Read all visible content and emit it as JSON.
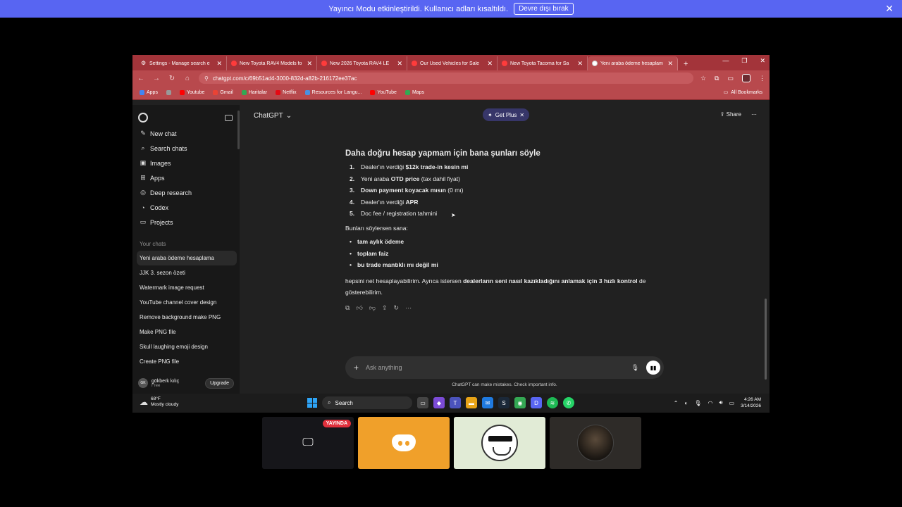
{
  "banner": {
    "text": "Yayıncı Modu etkinleştirildi. Kullanıcı adları kısaltıldı.",
    "button": "Devre dışı bırak",
    "close": "✕"
  },
  "browser": {
    "tabs": [
      {
        "title": "Settings - Manage search e",
        "icon": "gear-icon",
        "active": false
      },
      {
        "title": "New Toyota RAV4 Models fo",
        "icon": "toyota-icon",
        "active": false
      },
      {
        "title": "New 2026 Toyota RAV4 LE",
        "icon": "toyota-icon",
        "active": false
      },
      {
        "title": "Our Used Vehicles for Sale",
        "icon": "toyota-icon",
        "active": false
      },
      {
        "title": "New Toyota Tacoma for Sa",
        "icon": "toyota-icon",
        "active": false
      },
      {
        "title": "Yeni araba ödeme hesaplam",
        "icon": "chatgpt-icon",
        "active": true
      }
    ],
    "url": "chatgpt.com/c/69b51ad4-3000-832d-a82b-216172ee37ac",
    "bookmarks": [
      {
        "label": "Apps",
        "color": "#4285f4"
      },
      {
        "label": "",
        "color": "#999999"
      },
      {
        "label": "Youtube",
        "color": "#ff0000"
      },
      {
        "label": "Gmail",
        "color": "#ea4335"
      },
      {
        "label": "Haritalar",
        "color": "#34a853"
      },
      {
        "label": "Netflix",
        "color": "#e50914"
      },
      {
        "label": "Resources for Langu...",
        "color": "#4a90e2"
      },
      {
        "label": "YouTube",
        "color": "#ff0000"
      },
      {
        "label": "Maps",
        "color": "#34a853"
      }
    ],
    "all_bookmarks": "All Bookmarks"
  },
  "sidebar": {
    "items": [
      {
        "label": "New chat",
        "icon": "✎"
      },
      {
        "label": "Search chats",
        "icon": "⌕"
      },
      {
        "label": "Images",
        "icon": "▣"
      },
      {
        "label": "Apps",
        "icon": "⊞"
      },
      {
        "label": "Deep research",
        "icon": "◎"
      },
      {
        "label": "Codex",
        "icon": "◔"
      },
      {
        "label": "Projects",
        "icon": "▭"
      }
    ],
    "section_title": "Your chats",
    "chats": [
      "Yeni araba ödeme hesaplama",
      "JJK 3. sezon özeti",
      "Watermark image request",
      "YouTube channel cover design",
      "Remove background make PNG",
      "Make PNG file",
      "Skull laughing emoji design",
      "Create PNG file"
    ],
    "user": {
      "initials": "GK",
      "name": "gökberk kılıç",
      "plan": "Free",
      "upgrade": "Upgrade"
    }
  },
  "main": {
    "model": "ChatGPT",
    "get_plus": "Get Plus",
    "share": "Share",
    "heading": "Daha doğru hesap yapmam için bana şunları söyle",
    "list": [
      {
        "num": "1.",
        "pre": "Dealer'ın verdiği ",
        "bold": "$12k trade-in kesin mi",
        "post": ""
      },
      {
        "num": "2.",
        "pre": "Yeni araba ",
        "bold": "OTD price",
        "post": " (tax dahil fiyat)"
      },
      {
        "num": "3.",
        "pre": "",
        "bold": "Down payment koyacak mısın",
        "post": " (0 mı)"
      },
      {
        "num": "4.",
        "pre": "Dealer'ın verdiği ",
        "bold": "APR",
        "post": ""
      },
      {
        "num": "5.",
        "pre": "Doc fee / registration tahmini",
        "bold": "",
        "post": ""
      }
    ],
    "mid_text": "Bunları söylersen sana:",
    "bullets": [
      "tam aylık ödeme",
      "toplam faiz",
      "bu trade mantıklı mı değil mi"
    ],
    "final_pre": "hepsini net hesaplayabilirim. Ayrıca istersen ",
    "final_bold": "dealerların seni nasıl kazıkladığını anlamak için 3 hızlı kontrol",
    "final_post": " de gösterebilirim.",
    "composer_placeholder": "Ask anything",
    "disclaimer": "ChatGPT can make mistakes. Check important info."
  },
  "taskbar": {
    "weather_temp": "68°F",
    "weather_desc": "Mostly cloudy",
    "search": "Search",
    "time": "4:26 AM",
    "date": "3/14/2026"
  },
  "tiles": {
    "live": "YAYINDA"
  }
}
